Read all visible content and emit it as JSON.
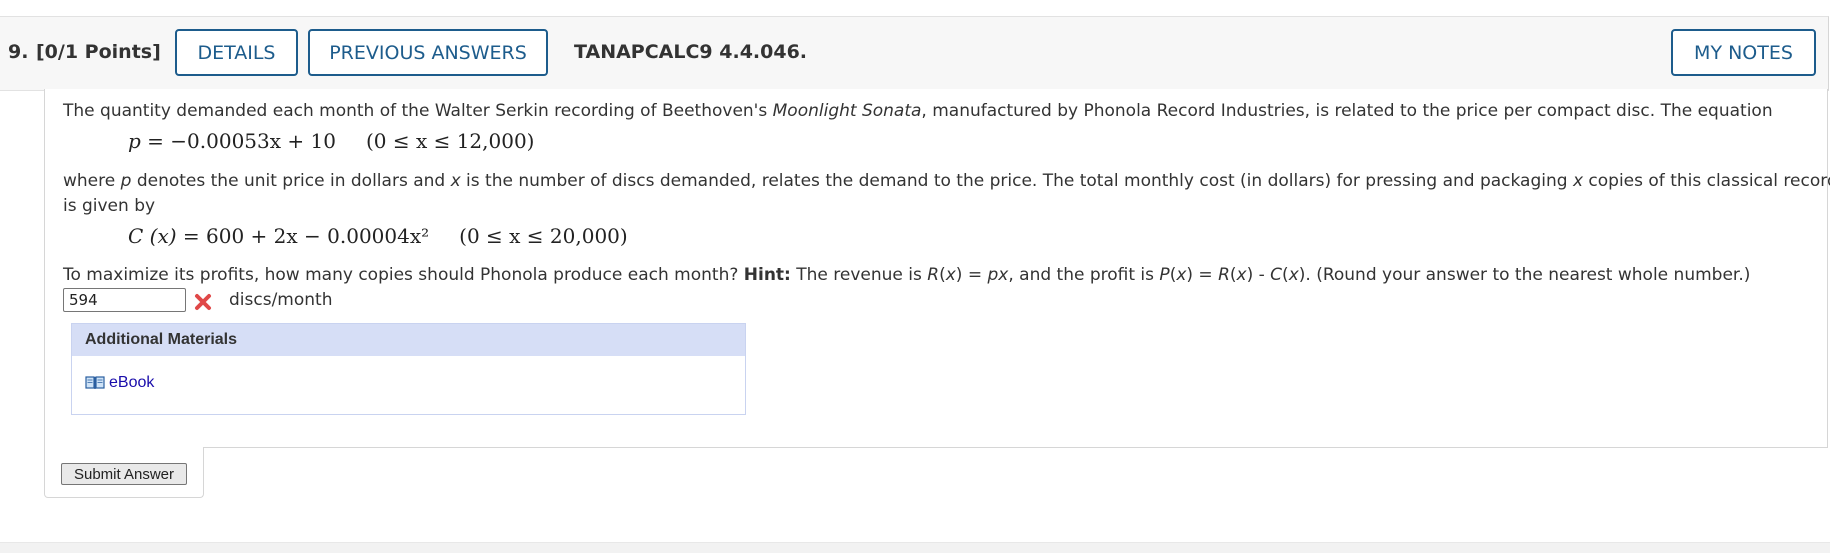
{
  "question": {
    "number": "9.",
    "points": "[0/1 Points]",
    "code": "TANAPCALC9 4.4.046."
  },
  "header_buttons": {
    "details": "DETAILS",
    "previous_answers": "PREVIOUS ANSWERS",
    "my_notes": "MY NOTES"
  },
  "problem": {
    "line1_pre": "The quantity demanded each month of the Walter Serkin recording of Beethoven's ",
    "line1_italic": "Moonlight Sonata",
    "line1_post": ", manufactured by Phonola Record Industries, is related to the price per compact disc. The equation",
    "equation1": {
      "lhs": "p",
      "rhs": " = −0.00053x + 10",
      "domain": "(0 ≤ x ≤ 12,000)"
    },
    "line2_a": "where ",
    "line2_p": "p",
    "line2_b": " denotes the unit price in dollars and ",
    "line2_x": "x",
    "line2_c": " is the number of discs demanded, relates the demand to the price. The total monthly cost (in dollars) for pressing and packaging ",
    "line2_x2": "x",
    "line2_d": " copies of this classical recording",
    "line3": "is given by",
    "equation2": {
      "lhs": "C (x)",
      "rhs": " = 600 + 2x − 0.00004x²",
      "domain": "(0 ≤ x ≤ 20,000)"
    },
    "question_pre": "To maximize its profits, how many copies should Phonola produce each month? ",
    "hint_label": "Hint:",
    "hint_a": " The revenue is ",
    "hint_r": "R",
    "hint_b": "(",
    "hint_x1": "x",
    "hint_c": ") = ",
    "hint_px": "px",
    "hint_d": ", and the profit is ",
    "hint_p": "P",
    "hint_e": "(",
    "hint_x2": "x",
    "hint_f": ") = ",
    "hint_r2": "R",
    "hint_g": "(",
    "hint_x3": "x",
    "hint_h": ") - ",
    "hint_c2": "C",
    "hint_i": "(",
    "hint_x4": "x",
    "hint_j": "). (Round your answer to the nearest whole number.)"
  },
  "answer": {
    "value": "594",
    "units": "discs/month",
    "status": "incorrect",
    "status_color": "#e04848"
  },
  "additional_materials": {
    "title": "Additional Materials",
    "ebook_label": "eBook",
    "ebook_icon": "book-icon"
  },
  "submit": {
    "label": "Submit Answer"
  },
  "colors": {
    "accent": "#1d5c8c",
    "materials_header": "#d6def6",
    "link": "#1a0dab"
  }
}
